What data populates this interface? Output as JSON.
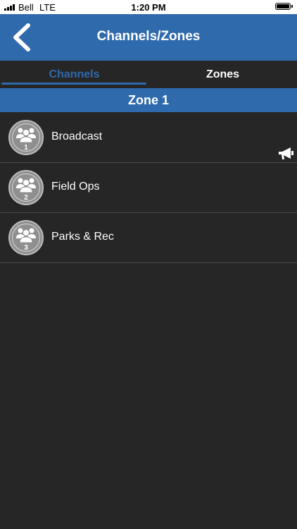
{
  "status_bar": {
    "carrier": "Bell",
    "network": "LTE",
    "time": "1:20 PM",
    "icons": [
      "signal-icon",
      "battery-icon"
    ]
  },
  "nav": {
    "title": "Channels/Zones",
    "back_icon": "chevron-left-icon"
  },
  "tabs": [
    {
      "label": "Channels",
      "active": true
    },
    {
      "label": "Zones",
      "active": false
    }
  ],
  "zone": {
    "title": "Zone 1"
  },
  "channels": [
    {
      "number": "1",
      "name": "Broadcast",
      "icon": "group-icon",
      "broadcasting": true
    },
    {
      "number": "2",
      "name": "Field Ops",
      "icon": "group-icon",
      "broadcasting": false
    },
    {
      "number": "3",
      "name": "Parks & Rec",
      "icon": "group-icon",
      "broadcasting": false
    }
  ],
  "colors": {
    "accent": "#2f6aad",
    "background": "#262626",
    "divider": "#4a4a4a",
    "avatar": "#8f8f8f"
  }
}
